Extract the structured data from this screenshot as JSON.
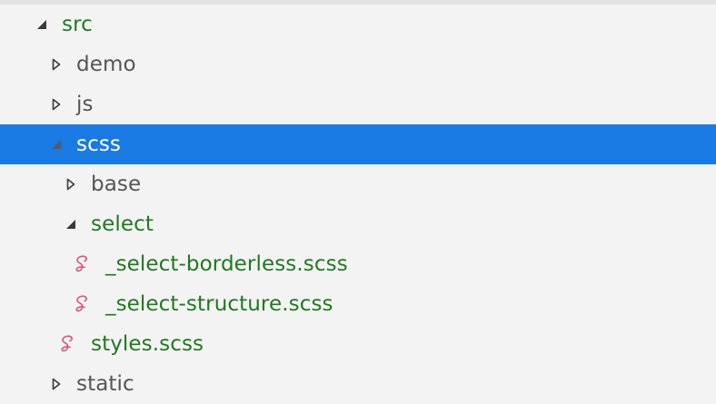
{
  "tree": {
    "src_label": "src",
    "demo_label": "demo",
    "js_label": "js",
    "scss_label": "scss",
    "base_label": "base",
    "select_label": "select",
    "select_borderless_label": "_select-borderless.scss",
    "select_structure_label": "_select-structure.scss",
    "styles_label": "styles.scss",
    "static_label": "static"
  },
  "colors": {
    "background": "#f3f3f3",
    "selection": "#1a7ae3",
    "git_added": "#1f7a1f",
    "default_text": "#555555",
    "sass_icon": "#d9547c"
  },
  "icons": {
    "expanded": "chevron-expanded-icon",
    "collapsed": "chevron-collapsed-icon",
    "sass_file": "sass-file-icon"
  }
}
